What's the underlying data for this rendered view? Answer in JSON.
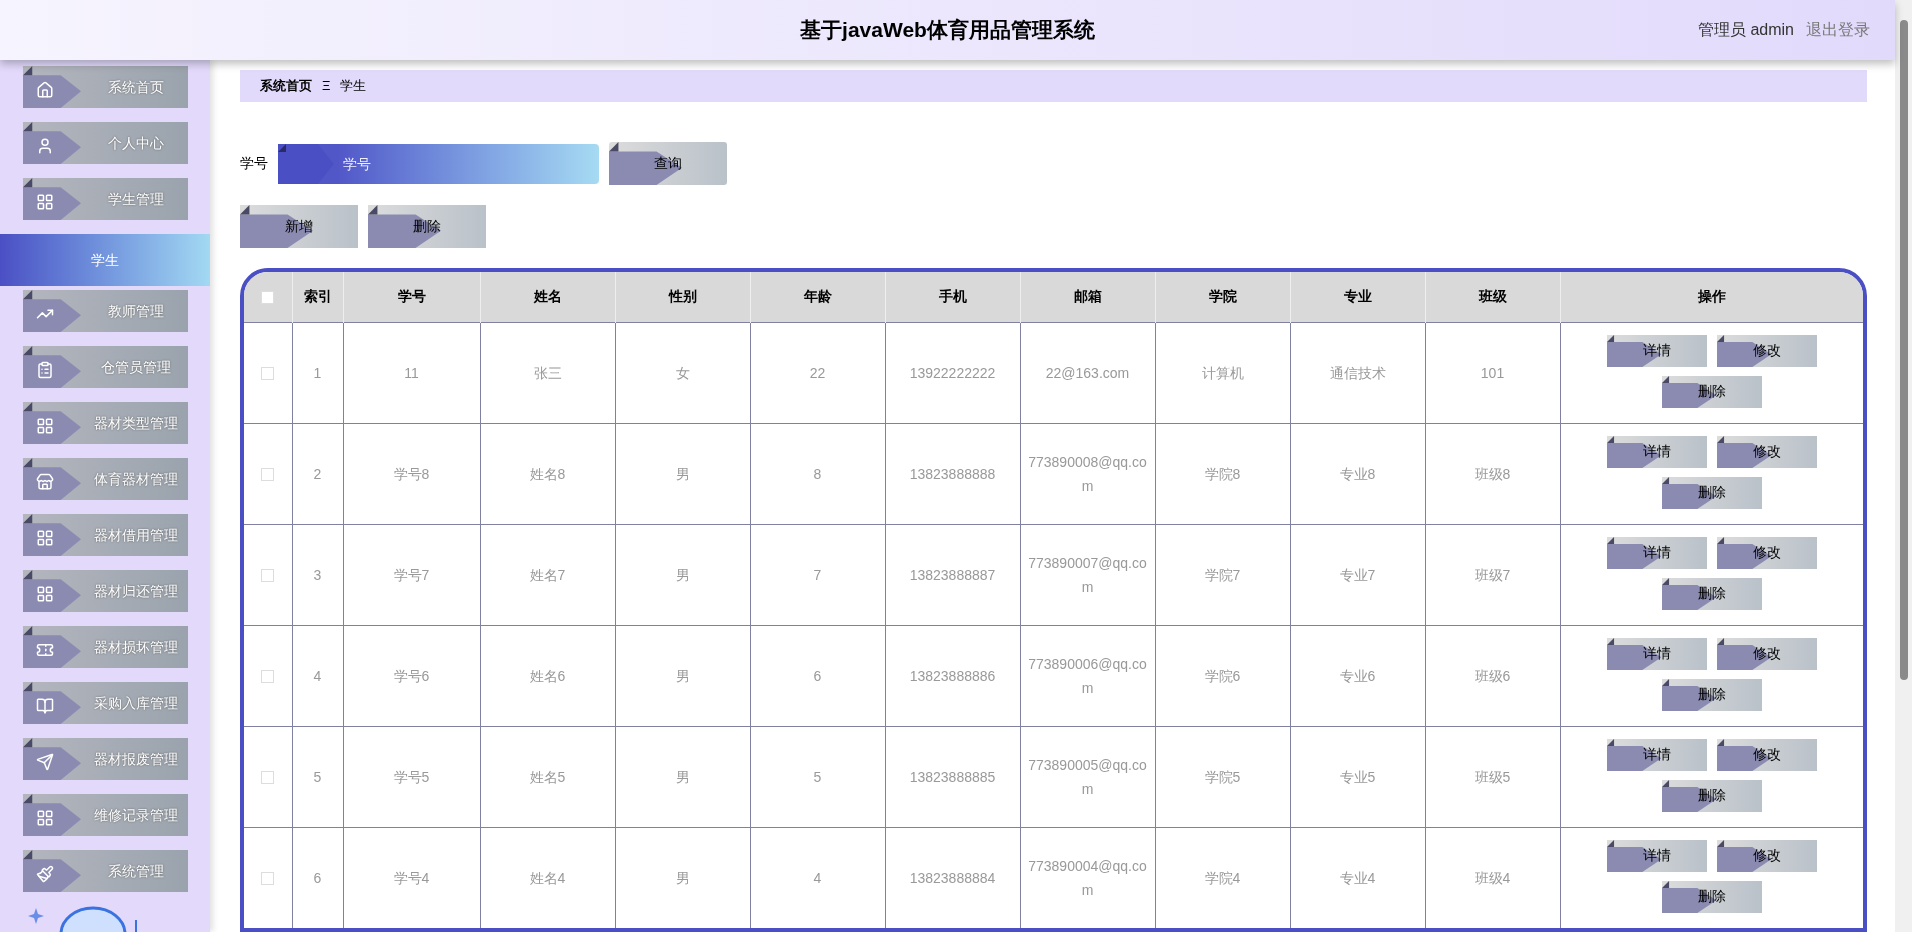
{
  "header": {
    "title": "基于javaWeb体育用品管理系统",
    "user": "管理员 admin",
    "logout": "退出登录"
  },
  "sidebar": {
    "items": [
      {
        "label": "系统首页",
        "selected": false
      },
      {
        "label": "个人中心",
        "selected": false
      },
      {
        "label": "学生管理",
        "selected": false
      },
      {
        "label": "学生",
        "selected": true
      },
      {
        "label": "教师管理",
        "selected": false
      },
      {
        "label": "仓管员管理",
        "selected": false
      },
      {
        "label": "器材类型管理",
        "selected": false
      },
      {
        "label": "体育器材管理",
        "selected": false
      },
      {
        "label": "器材借用管理",
        "selected": false
      },
      {
        "label": "器材归还管理",
        "selected": false
      },
      {
        "label": "器材损坏管理",
        "selected": false
      },
      {
        "label": "采购入库管理",
        "selected": false
      },
      {
        "label": "器材报废管理",
        "selected": false
      },
      {
        "label": "维修记录管理",
        "selected": false
      },
      {
        "label": "系统管理",
        "selected": false
      }
    ]
  },
  "breadcrumb": {
    "home": "系统首页",
    "separator": "Ξ",
    "current": "学生"
  },
  "search": {
    "label": "学号",
    "placeholder": "学号",
    "button": "查询"
  },
  "toolbar": [
    "新增",
    "删除"
  ],
  "table": {
    "columns": [
      "索引",
      "学号",
      "姓名",
      "性别",
      "年龄",
      "手机",
      "邮箱",
      "学院",
      "专业",
      "班级",
      "操作"
    ],
    "select_all_checked": false,
    "rows": [
      {
        "checked": false,
        "cells": [
          "1",
          "11",
          "张三",
          "女",
          "22",
          "13922222222",
          "22@163.com",
          "计算机",
          "通信技术",
          "101"
        ],
        "actions": [
          "详情",
          "修改",
          "删除"
        ]
      },
      {
        "checked": false,
        "cells": [
          "2",
          "学号8",
          "姓名8",
          "男",
          "8",
          "13823888888",
          "773890008@qq.com",
          "学院8",
          "专业8",
          "班级8"
        ],
        "actions": [
          "详情",
          "修改",
          "删除"
        ]
      },
      {
        "checked": false,
        "cells": [
          "3",
          "学号7",
          "姓名7",
          "男",
          "7",
          "13823888887",
          "773890007@qq.com",
          "学院7",
          "专业7",
          "班级7"
        ],
        "actions": [
          "详情",
          "修改",
          "删除"
        ]
      },
      {
        "checked": false,
        "cells": [
          "4",
          "学号6",
          "姓名6",
          "男",
          "6",
          "13823888886",
          "773890006@qq.com",
          "学院6",
          "专业6",
          "班级6"
        ],
        "actions": [
          "详情",
          "修改",
          "删除"
        ]
      },
      {
        "checked": false,
        "cells": [
          "5",
          "学号5",
          "姓名5",
          "男",
          "5",
          "13823888885",
          "773890005@qq.com",
          "学院5",
          "专业5",
          "班级5"
        ],
        "actions": [
          "详情",
          "修改",
          "删除"
        ]
      },
      {
        "checked": false,
        "cells": [
          "6",
          "学号4",
          "姓名4",
          "男",
          "4",
          "13823888884",
          "773890004@qq.com",
          "学院4",
          "专业4",
          "班级4"
        ],
        "actions": [
          "详情",
          "修改",
          "删除"
        ]
      }
    ]
  }
}
